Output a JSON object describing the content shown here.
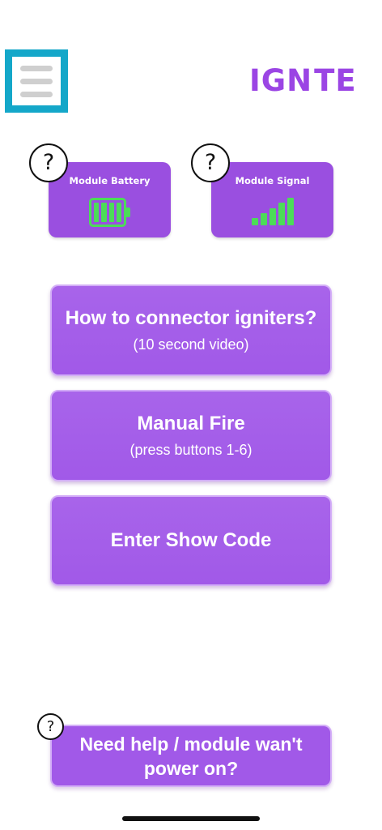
{
  "header": {
    "menu_icon": "hamburger-menu-icon",
    "logo_text_left": "IGN",
    "logo_text_right": "TE",
    "logo_icon": "feather-icon",
    "accent_color": "#9b45e4",
    "highlight_color": "#14a7c9"
  },
  "status": {
    "battery": {
      "title": "Module Battery",
      "help": "?",
      "icon": "battery-full-icon",
      "level_fraction": 1.0
    },
    "signal": {
      "title": "Module Signal",
      "help": "?",
      "icon": "signal-strength-icon",
      "bars_filled": 5,
      "bars_total": 5
    }
  },
  "actions": {
    "connect": {
      "title": "How to connector igniters?",
      "subtitle": "(10 second video)"
    },
    "manual_fire": {
      "title": "Manual Fire",
      "subtitle": "(press buttons 1-6)"
    },
    "show_code": {
      "title": "Enter Show Code"
    }
  },
  "help": {
    "badge": "?",
    "label": "Need help / module wan't power on?"
  },
  "colors": {
    "button_purple": "#a159e8",
    "status_green": "#4cdc58"
  }
}
